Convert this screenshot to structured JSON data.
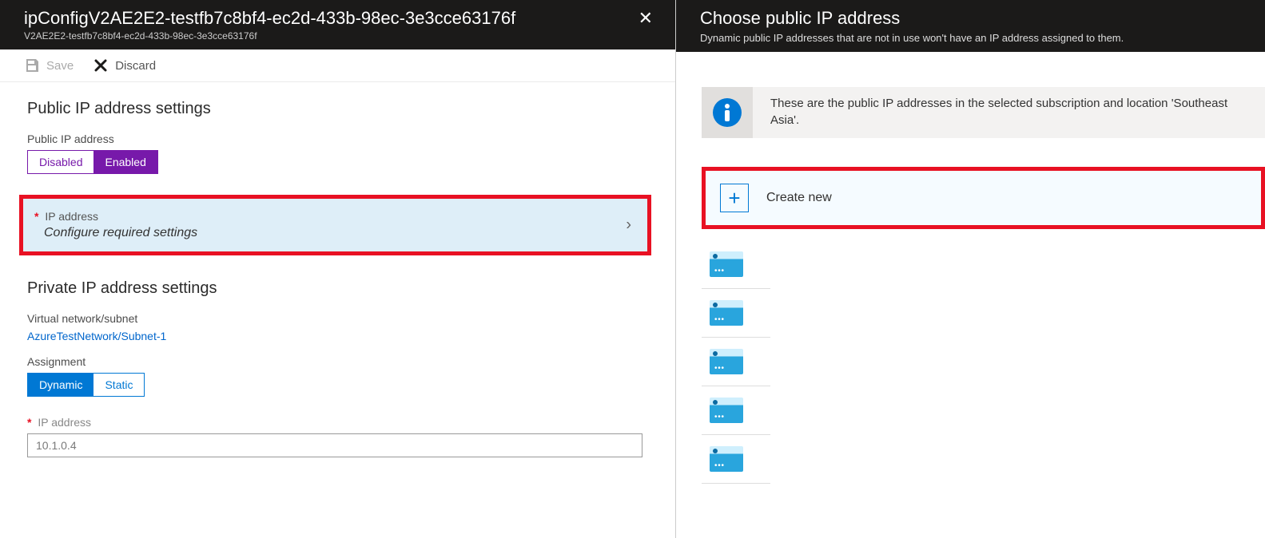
{
  "left": {
    "title": "ipConfigV2AE2E2-testfb7c8bf4-ec2d-433b-98ec-3e3cce63176f",
    "breadcrumb": "V2AE2E2-testfb7c8bf4-ec2d-433b-98ec-3e3cce63176f",
    "toolbar": {
      "save": "Save",
      "discard": "Discard"
    },
    "public_section_title": "Public IP address settings",
    "public_ip_label": "Public IP address",
    "toggle_public": {
      "off": "Disabled",
      "on": "Enabled"
    },
    "ip_address_label": "IP address",
    "configure_text": "Configure required settings",
    "private_section_title": "Private IP address settings",
    "vnet_label": "Virtual network/subnet",
    "vnet_value": "AzureTestNetwork/Subnet-1",
    "assignment_label": "Assignment",
    "toggle_assign": {
      "on": "Dynamic",
      "off": "Static"
    },
    "ip_field_label": "IP address",
    "ip_field_value": "10.1.0.4"
  },
  "right": {
    "title": "Choose public IP address",
    "desc": "Dynamic public IP addresses that are not in use won't have an IP address assigned to them.",
    "info": "These are the public IP addresses in the selected subscription and location 'Southeast Asia'.",
    "create_new": "Create new",
    "ip_items_count": 5
  }
}
